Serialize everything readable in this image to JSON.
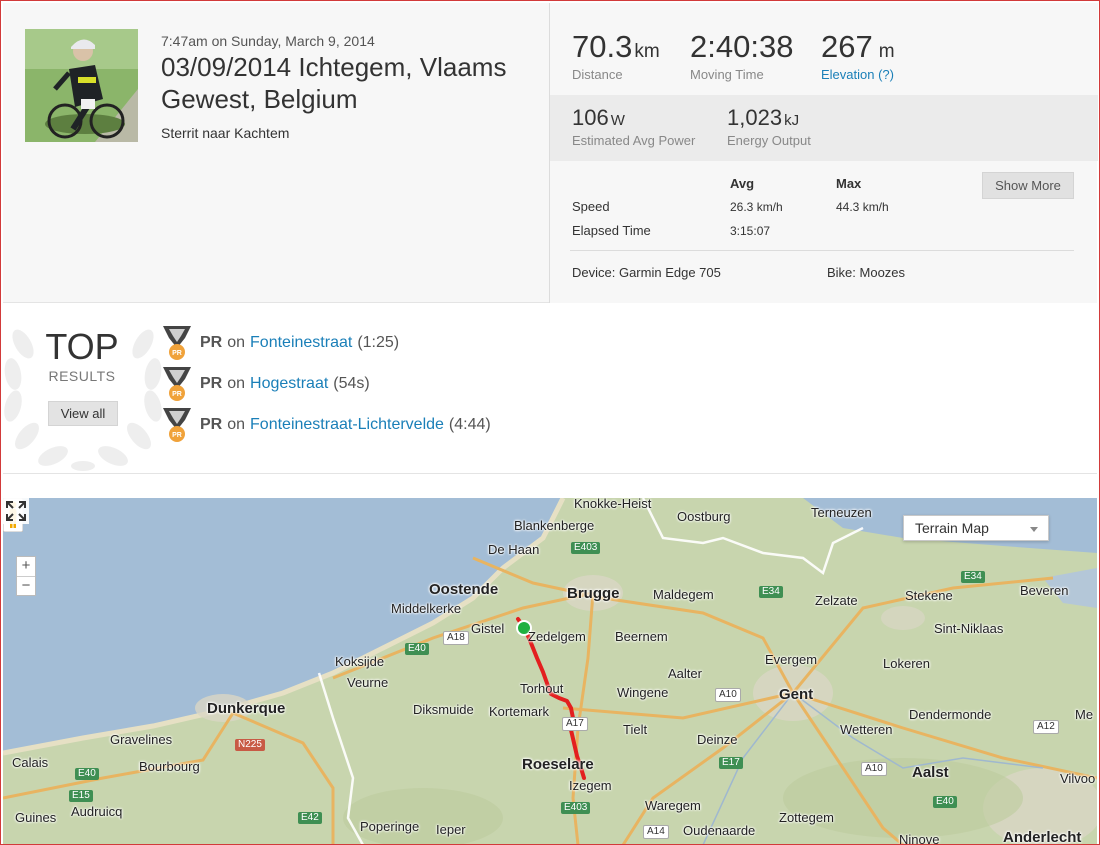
{
  "activity": {
    "date": "7:47am on Sunday, March 9, 2014",
    "title": "03/09/2014 Ichtegem, Vlaams Gewest, Belgium",
    "description": "Sterrit naar Kachtem"
  },
  "stats": {
    "distance": {
      "value": "70.3",
      "unit": "km",
      "label": "Distance"
    },
    "moving_time": {
      "value": "2:40:38",
      "label": "Moving Time"
    },
    "elevation": {
      "value": "267",
      "unit": "m",
      "label": "Elevation (?)"
    },
    "power": {
      "value": "106",
      "unit": "W",
      "label": "Estimated Avg Power"
    },
    "energy": {
      "value": "1,023",
      "unit": "kJ",
      "label": "Energy Output"
    }
  },
  "details": {
    "avg_header": "Avg",
    "max_header": "Max",
    "speed_label": "Speed",
    "speed_avg": "26.3 km/h",
    "speed_max": "44.3 km/h",
    "elapsed_label": "Elapsed Time",
    "elapsed_avg": "3:15:07",
    "show_more": "Show More",
    "device": "Device: Garmin Edge 705",
    "bike": "Bike: Moozes"
  },
  "top_results": {
    "title": "TOP",
    "subtitle": "RESULTS",
    "view_all": "View all",
    "items": [
      {
        "tag": "PR",
        "on": "on",
        "segment": "Fonteinestraat",
        "time": "(1:25)"
      },
      {
        "tag": "PR",
        "on": "on",
        "segment": "Hogestraat",
        "time": "(54s)"
      },
      {
        "tag": "PR",
        "on": "on",
        "segment": "Fonteinestraat-Lichtervelde",
        "time": "(4:44)"
      }
    ],
    "medal_text": "PR"
  },
  "map": {
    "map_type": "Terrain Map",
    "zoom_in": "+",
    "zoom_out": "−",
    "places": {
      "knokke": "Knokke-Heist",
      "blankenberge": "Blankenberge",
      "oostburg": "Oostburg",
      "terneuzen": "Terneuzen",
      "dehaan": "De Haan",
      "oostende": "Oostende",
      "brugge": "Brugge",
      "maldegem": "Maldegem",
      "zelzate": "Zelzate",
      "stekene": "Stekene",
      "beveren": "Beveren",
      "middelkerke": "Middelkerke",
      "gistel": "Gistel",
      "zedelgem": "Zedelgem",
      "beernem": "Beernem",
      "sintniklaas": "Sint-Niklaas",
      "koksijde": "Koksijde",
      "evergem": "Evergem",
      "lokeren": "Lokeren",
      "veurne": "Veurne",
      "aalter": "Aalter",
      "torhout": "Torhout",
      "wingene": "Wingene",
      "gent": "Gent",
      "dunkerque": "Dunkerque",
      "diksmuide": "Diksmuide",
      "kortemark": "Kortemark",
      "dendermonde": "Dendermonde",
      "tielt": "Tielt",
      "gravelines": "Gravelines",
      "wetteren": "Wetteren",
      "bourbourg": "Bourbourg",
      "deinze": "Deinze",
      "roeselare": "Roeselare",
      "calais": "Calais",
      "izegem": "Izegem",
      "aalst": "Aalst",
      "vilvoorde": "Vilvoo",
      "me": "Me",
      "audruicq": "Audruicq",
      "waregem": "Waregem",
      "guines": "Guines",
      "poperinge": "Poperinge",
      "ieper": "Ieper",
      "oudenaarde": "Oudenaarde",
      "zottegem": "Zottegem",
      "ninove": "Ninove",
      "anderlecht": "Anderlecht"
    },
    "roads": {
      "e403_top": "E403",
      "e34_a": "E34",
      "e34_b": "E34",
      "a18": "A18",
      "e40_a": "E40",
      "a10_a": "A10",
      "a17": "A17",
      "a12": "A12",
      "n225": "N225",
      "e40_b": "E40",
      "e17": "E17",
      "a10_b": "A10",
      "e15": "E15",
      "e42": "E42",
      "e403_b": "E403",
      "a14": "A14",
      "e40_c": "E40"
    }
  }
}
